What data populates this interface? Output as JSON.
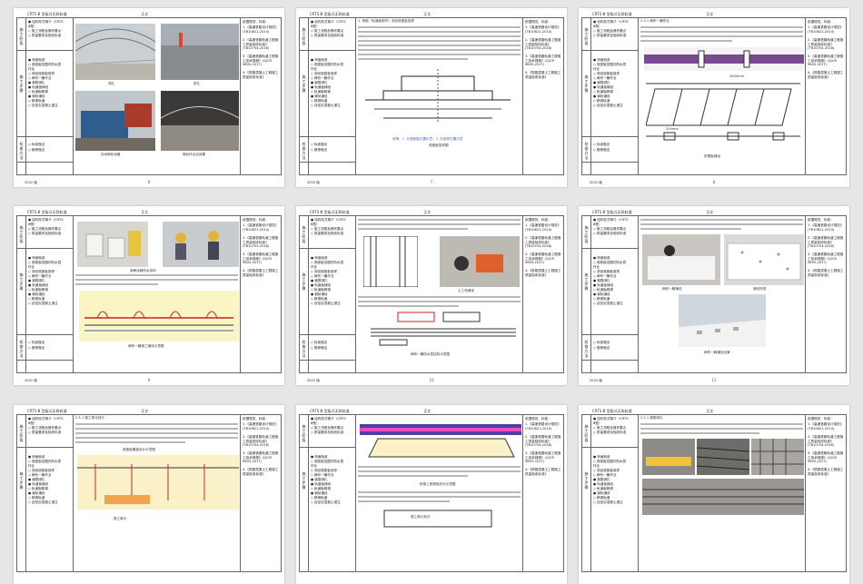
{
  "header": {
    "doc_title": "CRTS Ⅲ 型板式无砟轨道",
    "center": "正文"
  },
  "left_labels": {
    "gongyi": "施工阶段",
    "buzhou": "施工步骤",
    "jiance": "检查方法",
    "year": "2022 版"
  },
  "toc": {
    "top": [
      "● 结构形式简介（CRTS",
      "Ⅲ型）",
      "◇ 施工流程及操作要点",
      "◇ 质量要求及验收标准"
    ],
    "middle": [
      "● 桥面验收",
      "◇ 底座板范围内防水层",
      "作业",
      "◇ 测设底座板放样",
      "◇ 两布一膜作业",
      "● 钢筋绑扎",
      "● 轨道板铺设",
      "◇ 轨道板精调",
      "● 钢轨铺设",
      "◇ 精调轨道",
      "◇ 自密实混凝土灌注"
    ],
    "bottom": [
      "◇ 标准做法",
      "◇ 推荐做法"
    ]
  },
  "right_col": [
    "依据规范、标准：",
    "1.《高速铁路设计规范》(TB10621-2014)",
    "2.《高速铁路轨道工程施工质量验收标准》(TB10754-2018)",
    "3.《高速铁路轨道工程施工技术规程》(Q/CR 9605-2017)",
    "4.《铁路混凝土工程施工质量验收标准》",
    "（铁建设〔2009〕",
    "210号）"
  ],
  "pages": [
    {
      "number": "6",
      "captions": [
        "测孔",
        "拔孔",
        "自动喷砂设备",
        "喷砂作业后效果"
      ]
    },
    {
      "number": "7",
      "section": "2. 桥面（轨道板制作）测设底座板放样",
      "captions": [
        "说明：1. 为底座板位置示意；2. 为放样位置示意",
        "底座板放样图"
      ]
    },
    {
      "number": "8",
      "section": "2.3.1 两布一膜作业",
      "captions": [
        "2650mm",
        "底座板伸缩缝",
        "200mm",
        "挤塑板铺设"
      ]
    },
    {
      "number": "9",
      "captions": [
        "滚刷涂刷防水涂料",
        "两布一膜施工铺设示意图"
      ]
    },
    {
      "number": "10",
      "captions": [
        "土工布铺设",
        "上层土工布及防水层材料",
        "两布一膜防水层结构示意图"
      ]
    },
    {
      "number": "11",
      "captions": [
        "两布一膜铺设",
        "铺设完成",
        "两布一膜铺设全景"
      ]
    },
    {
      "number": "12",
      "section": "2.5.1 施工单元划分",
      "captions": [
        "底座板模板设计示意图",
        "施工单元"
      ]
    },
    {
      "number": "13",
      "captions": [
        "桥梁上底座板划分示意图",
        "施工单元划分"
      ]
    },
    {
      "number": "14",
      "section": "2.5.1 钢筋绑扎",
      "captions": [
        "钢筋加工",
        "钢筋绑扎",
        "钢筋网片",
        "钢筋网片存放"
      ]
    }
  ]
}
